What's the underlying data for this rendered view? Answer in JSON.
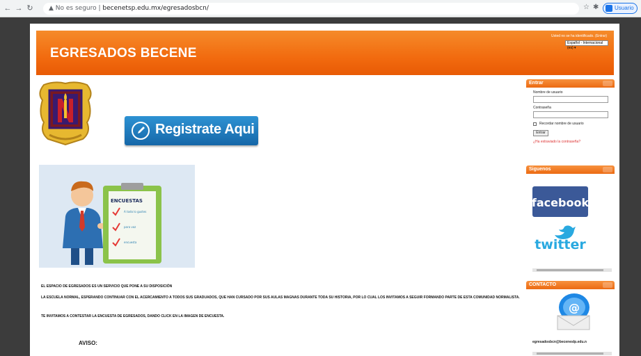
{
  "browser": {
    "security_warning": "No es seguro",
    "url": "becenetsp.edu.mx/egresadosbcn/",
    "profile_label": "Usuario"
  },
  "header": {
    "title": "EGRESADOS BECENE",
    "login_note": "Usted no se ha identificado. (Entrar)",
    "language": "Español - Internacional (es)"
  },
  "main": {
    "register_label": "Registrate Aqui",
    "survey_title": "ENCUESTAS",
    "survey_items": [
      "A todo lo gustes",
      "para voz",
      "encuesta"
    ],
    "paragraph_1": "El espacio de egresados es un servicio que pone a su disposición",
    "paragraph_2": "La Escuela Normal, esperando continuar con el acercamiento a todos sus graduados, que han cursado por sus aulas magnas durante toda su historia, por lo cual los invitamos a seguir formando parte de esta comunidad normalista.",
    "paragraph_3": "Te invitamos a contestar la encuesta de egresados, dando click en la imagen de encuesta.",
    "aviso": "AVISO:"
  },
  "sidebar": {
    "login": {
      "title": "Entrar",
      "username_label": "Nombre de usuario",
      "password_label": "Contraseña",
      "remember_label": "Recordar nombre de usuario",
      "submit_label": "Entrar",
      "forgot_label": "¿Ha extraviado la contraseña?"
    },
    "follow": {
      "title": "Siguenos",
      "facebook": "facebook",
      "twitter": "twitter"
    },
    "contact": {
      "title": "CONTACTO",
      "email": "egresadosbcn@becenesIp.edu.n"
    }
  },
  "colors": {
    "banner_orange": "#f26b0f",
    "button_blue": "#1667a8",
    "facebook_blue": "#3b5998",
    "twitter_blue": "#29a9e0"
  }
}
